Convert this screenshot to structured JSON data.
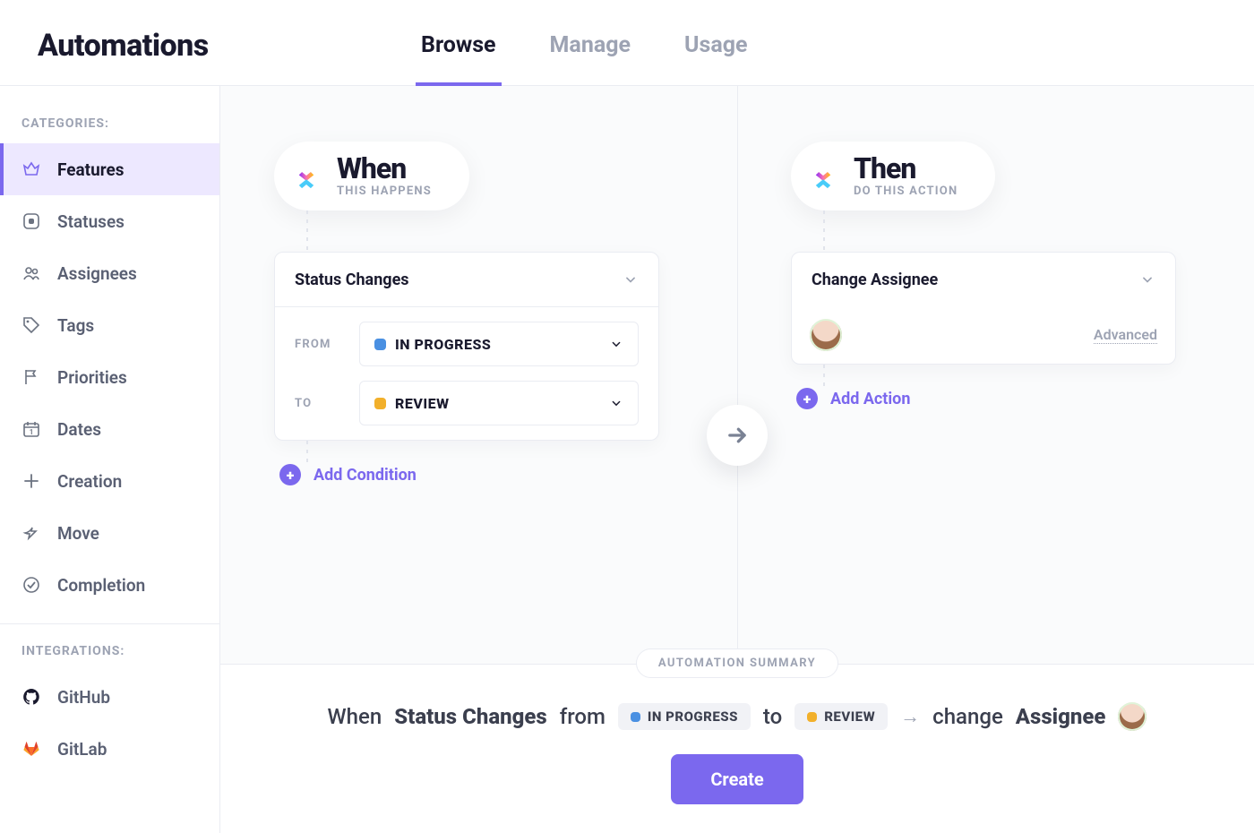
{
  "header": {
    "title": "Automations",
    "tabs": [
      {
        "label": "Browse",
        "active": true
      },
      {
        "label": "Manage",
        "active": false
      },
      {
        "label": "Usage",
        "active": false
      }
    ]
  },
  "sidebar": {
    "categories_label": "CATEGORIES:",
    "integrations_label": "INTEGRATIONS:",
    "categories": [
      {
        "label": "Features",
        "icon": "crown",
        "active": true
      },
      {
        "label": "Statuses",
        "icon": "status",
        "active": false
      },
      {
        "label": "Assignees",
        "icon": "people",
        "active": false
      },
      {
        "label": "Tags",
        "icon": "tag",
        "active": false
      },
      {
        "label": "Priorities",
        "icon": "flag",
        "active": false
      },
      {
        "label": "Dates",
        "icon": "calendar",
        "active": false
      },
      {
        "label": "Creation",
        "icon": "plus",
        "active": false
      },
      {
        "label": "Move",
        "icon": "share",
        "active": false
      },
      {
        "label": "Completion",
        "icon": "check",
        "active": false
      }
    ],
    "integrations": [
      {
        "label": "GitHub",
        "icon": "github"
      },
      {
        "label": "GitLab",
        "icon": "gitlab"
      }
    ]
  },
  "builder": {
    "when": {
      "title": "When",
      "subtitle": "THIS HAPPENS",
      "trigger": "Status Changes",
      "from": {
        "label": "FROM",
        "status": "IN PROGRESS",
        "color": "blue"
      },
      "to": {
        "label": "TO",
        "status": "REVIEW",
        "color": "yellow"
      },
      "add_label": "Add Condition"
    },
    "then": {
      "title": "Then",
      "subtitle": "DO THIS ACTION",
      "action": "Change Assignee",
      "advanced_label": "Advanced",
      "add_label": "Add Action"
    }
  },
  "summary": {
    "pill": "AUTOMATION SUMMARY",
    "when_word": "When",
    "trigger": "Status Changes",
    "from_word": "from",
    "from_status": "IN PROGRESS",
    "to_word": "to",
    "to_status": "REVIEW",
    "change_word": "change",
    "target": "Assignee",
    "create_button": "Create"
  }
}
